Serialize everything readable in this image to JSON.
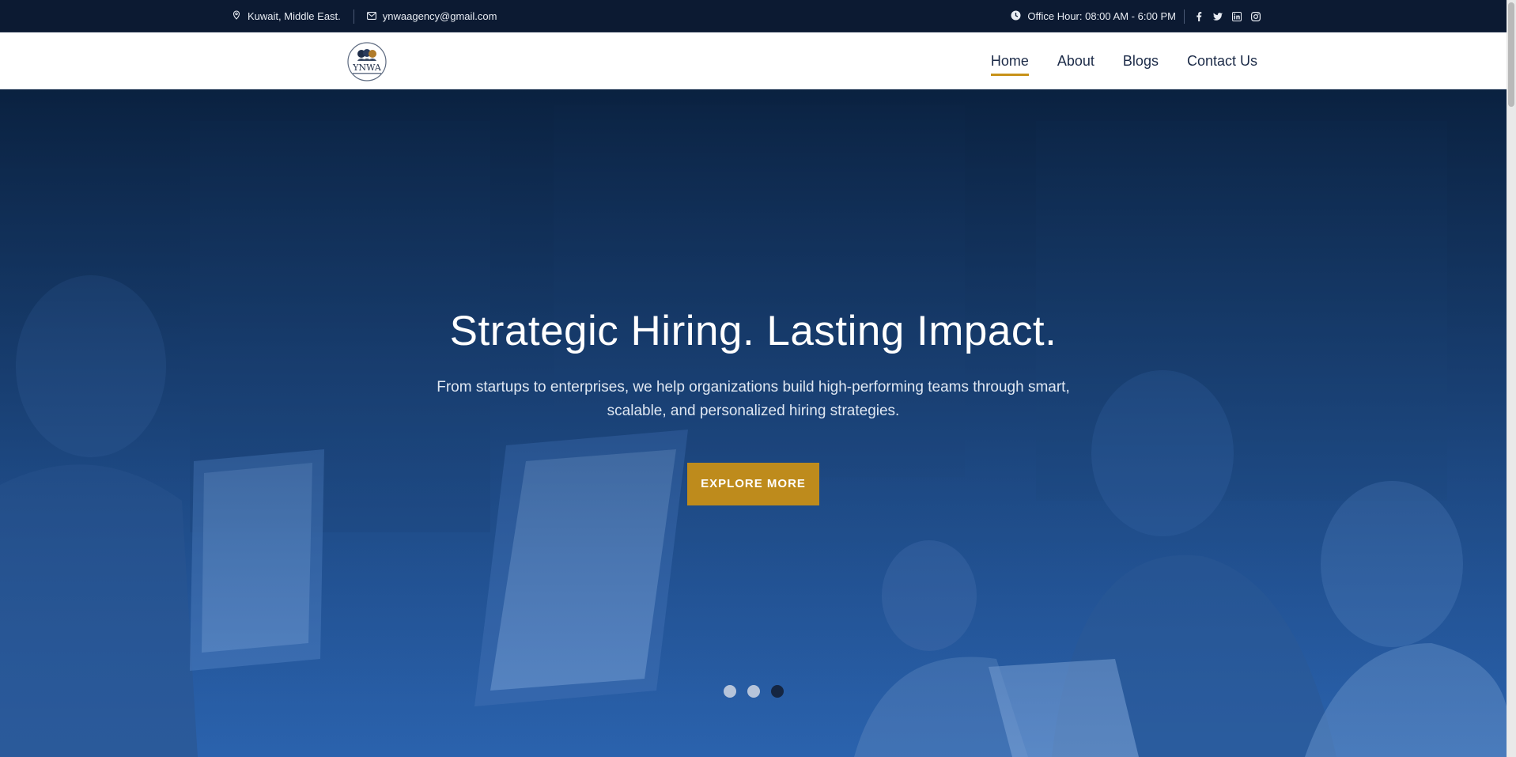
{
  "topbar": {
    "location": "Kuwait, Middle East.",
    "email": "ynwaagency@gmail.com",
    "office_hours": "Office Hour: 08:00 AM - 6:00 PM",
    "icons": [
      "location-pin-icon",
      "mail-icon",
      "clock-icon",
      "facebook-icon",
      "twitter-icon",
      "linkedin-icon",
      "instagram-icon"
    ]
  },
  "nav": {
    "items": [
      {
        "label": "Home",
        "active": true
      },
      {
        "label": "About"
      },
      {
        "label": "Blogs"
      },
      {
        "label": "Contact Us"
      }
    ]
  },
  "logo": {
    "lettering": "YNWA"
  },
  "hero": {
    "title": "Strategic Hiring. Lasting Impact.",
    "subtitle": "From startups to enterprises, we help organizations build high-performing teams through smart, scalable, and personalized hiring strategies.",
    "cta_label": "EXPLORE MORE",
    "slides": 3,
    "active_slide": 3
  },
  "colors": {
    "topbar_bg": "#0c1a32",
    "accent": "#c79219",
    "nav_text": "#1b2a47",
    "hero_overlay": "#1d4a86"
  }
}
